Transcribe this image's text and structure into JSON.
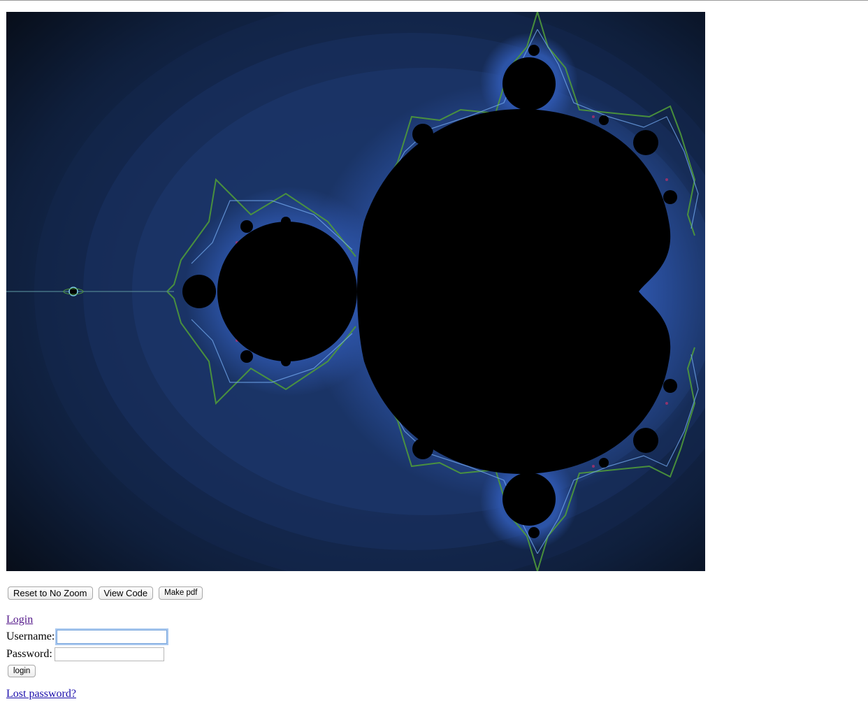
{
  "toolbar": {
    "reset_label": "Reset to No Zoom",
    "view_code_label": "View Code",
    "make_pdf_label": "Make pdf"
  },
  "login": {
    "heading_link": "Login",
    "username_label": "Username:",
    "username_value": "",
    "password_label": "Password:",
    "password_value": "",
    "submit_label": "login",
    "lost_password_link": "Lost password?"
  },
  "fractal": {
    "name": "mandelbrot-set",
    "set_color": "#000000",
    "background_color": "#0a1424",
    "edge_colors": [
      "#3a62b8",
      "#4f9a3a",
      "#7fd0e8",
      "#c0306a"
    ]
  },
  "icons": {
    "text_cursor": "text-caret-icon"
  }
}
